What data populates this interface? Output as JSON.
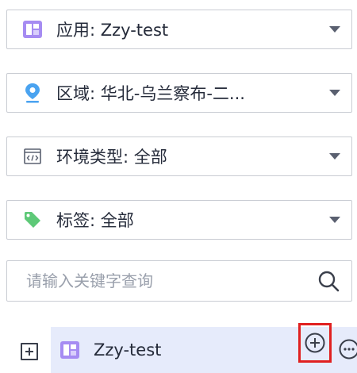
{
  "filters": {
    "app": {
      "label": "应用:  Zzy-test",
      "icon": "app-grid-icon"
    },
    "region": {
      "label": "区域:  华北-乌兰察布-二...",
      "icon": "location-pin-icon"
    },
    "env_type": {
      "label": "环境类型:  全部",
      "icon": "code-window-icon"
    },
    "tag": {
      "label": "标签:  全部",
      "icon": "tag-icon"
    }
  },
  "search": {
    "placeholder": "请输入关键字查询",
    "value": "",
    "icon": "search-icon"
  },
  "tree": {
    "node_label": "Zzy-test",
    "node_icon": "app-grid-icon",
    "actions": [
      "add-circle-icon",
      "more-circle-icon"
    ]
  },
  "colors": {
    "app_icon": "#a68cf2",
    "location_icon": "#4aa3f0",
    "tag_icon": "#5ec978",
    "selected_row": "#e6ebfb",
    "highlight_border": "#e02020"
  }
}
